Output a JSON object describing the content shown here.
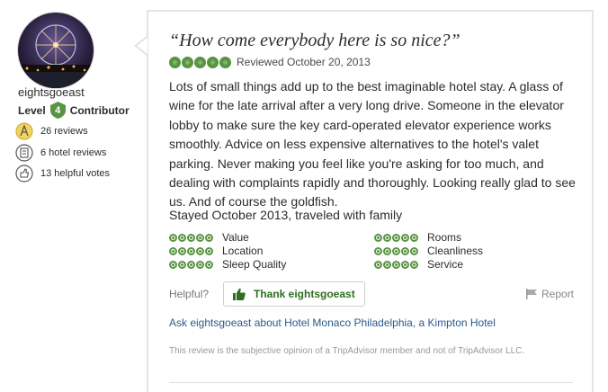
{
  "member": {
    "username": "eightsgoeast",
    "level_prefix": "Level",
    "level_number": "4",
    "level_suffix": "Contributor",
    "stats": [
      {
        "icon": "quill-badge-icon",
        "text": "26 reviews"
      },
      {
        "icon": "hotel-building-icon",
        "text": "6 hotel reviews"
      },
      {
        "icon": "helpful-thumbs-icon",
        "text": "13 helpful votes"
      }
    ],
    "colors": {
      "level_badge": "#589442"
    }
  },
  "review": {
    "title": "“How come everybody here is so nice?”",
    "rating": 5,
    "reviewed_date": "Reviewed October 20, 2013",
    "body": "Lots of small things add up to the best imaginable hotel stay. A glass of wine for the late arrival after a very long drive. Someone in the elevator lobby to make sure the key card-operated elevator experience works smoothly. Advice on less expensive alternatives to the hotel's valet parking. Never making you feel like you're asking for too much, and dealing with complaints rapidly and thoroughly. Looking really glad to see us. And of course the goldfish.",
    "stayed": "Stayed October 2013, traveled with family",
    "sub_ratings": [
      {
        "label": "Value",
        "rating": 5
      },
      {
        "label": "Location",
        "rating": 5
      },
      {
        "label": "Sleep Quality",
        "rating": 5
      },
      {
        "label": "Rooms",
        "rating": 5
      },
      {
        "label": "Cleanliness",
        "rating": 5
      },
      {
        "label": "Service",
        "rating": 5
      }
    ],
    "helpful_label": "Helpful?",
    "thank_button": "Thank eightsgoeast",
    "report_label": "Report",
    "ask_link": "Ask eightsgoeast about Hotel Monaco Philadelphia, a Kimpton Hotel",
    "disclaimer": "This review is the subjective opinion of a TripAdvisor member and not of TripAdvisor LLC.",
    "colors": {
      "rating_green": "#589442",
      "link_blue": "#2a5a8c"
    }
  }
}
